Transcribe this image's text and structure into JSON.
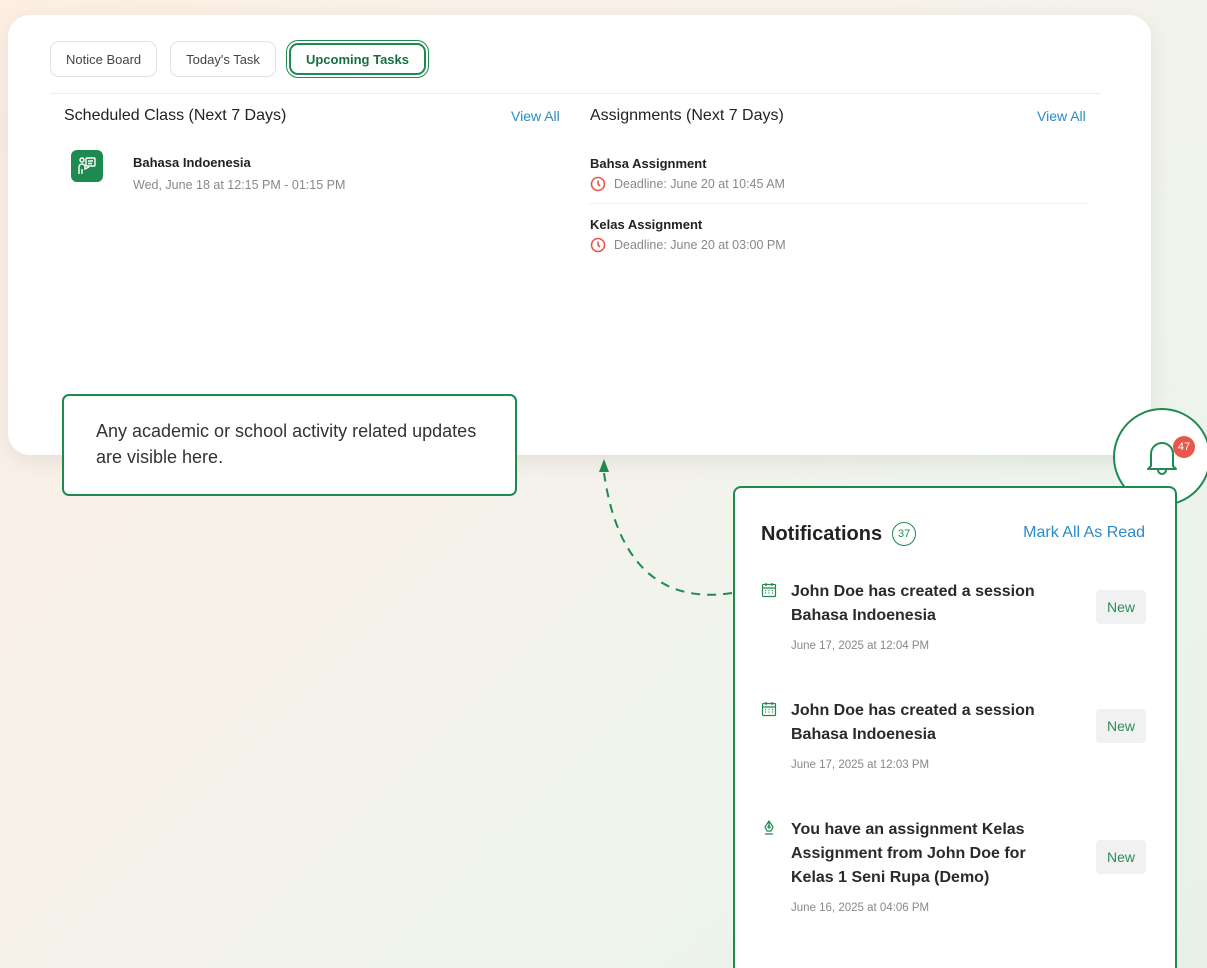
{
  "tabs": [
    {
      "label": "Notice Board",
      "active": false
    },
    {
      "label": "Today's Task",
      "active": false
    },
    {
      "label": "Upcoming Tasks",
      "active": true
    }
  ],
  "scheduled": {
    "title": "Scheduled Class (Next 7 Days)",
    "view_all": "View All",
    "items": [
      {
        "name": "Bahasa Indoenesia",
        "time": "Wed, June 18 at 12:15 PM - 01:15 PM",
        "icon": "teacher-board-icon"
      }
    ]
  },
  "assignments": {
    "title": "Assignments (Next 7 Days)",
    "view_all": "View All",
    "items": [
      {
        "name": "Bahsa Assignment",
        "deadline": "Deadline: June 20 at 10:45 AM"
      },
      {
        "name": "Kelas Assignment",
        "deadline": "Deadline: June 20 at 03:00 PM"
      }
    ]
  },
  "tooltip": {
    "text": "Any academic or school activity related updates are visible here."
  },
  "bell": {
    "count": "47"
  },
  "notifications": {
    "title": "Notifications",
    "count": "37",
    "mark_all": "Mark All As Read",
    "items": [
      {
        "icon": "calendar-icon",
        "message": "John Doe has created a session Bahasa Indoenesia",
        "date": "June 17, 2025 at 12:04 PM",
        "badge": "New"
      },
      {
        "icon": "calendar-icon",
        "message": "John Doe has created a session Bahasa Indoenesia",
        "date": "June 17, 2025 at 12:03 PM",
        "badge": "New"
      },
      {
        "icon": "pen-nib-icon",
        "message": "You have an assignment Kelas Assignment from John Doe for Kelas 1 Seni Rupa (Demo)",
        "date": "June 16, 2025 at 04:06 PM",
        "badge": "New"
      }
    ]
  },
  "colors": {
    "accent": "#1f8a4f",
    "link": "#2a8bc7",
    "alert": "#e8574a"
  }
}
